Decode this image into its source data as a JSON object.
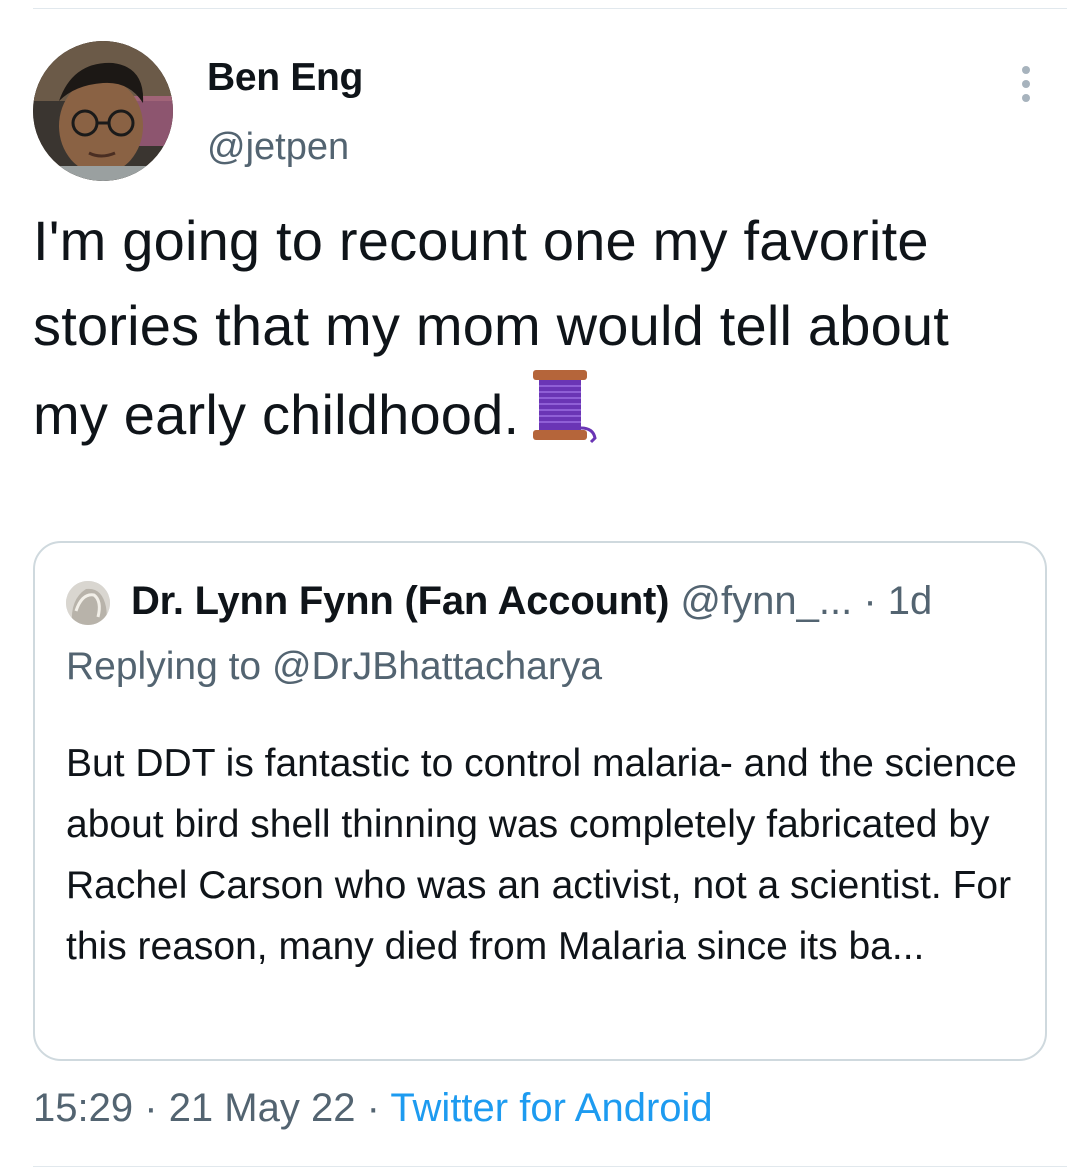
{
  "author": {
    "display_name": "Ben Eng",
    "handle": "@jetpen"
  },
  "tweet": {
    "text": "I'm going to recount one my favorite stories that my mom would tell about my early childhood.",
    "emoji_icon": "thread-spool-icon"
  },
  "quoted_tweet": {
    "display_name": "Dr. Lynn Fynn (Fan Account)",
    "handle": "@fynn_...",
    "separator": "·",
    "time": "1d",
    "replying_to_prefix": "Replying to",
    "replying_to_handle": "@DrJBhattacharya",
    "text": "But DDT is fantastic to control malaria- and the science about bird shell thinning was completely fabricated by Rachel Carson who was an activist, not a scientist. For this reason, many died from Malaria since its ba..."
  },
  "meta": {
    "time": "15:29",
    "separator": "·",
    "date": "21 May 22",
    "source": "Twitter for Android"
  },
  "colors": {
    "primary_text": "#0f1419",
    "secondary_text": "#536471",
    "accent": "#1d9bf0",
    "border": "#cfd9de"
  }
}
